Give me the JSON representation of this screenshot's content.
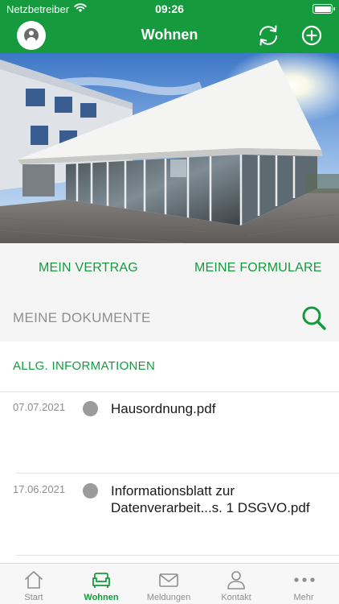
{
  "status_bar": {
    "carrier": "Netzbetreiber",
    "time": "09:26"
  },
  "header": {
    "title": "Wohnen",
    "icons": [
      "profile-icon",
      "refresh-icon",
      "add-icon"
    ]
  },
  "quick_links": {
    "contract": "MEIN VERTRAG",
    "forms": "MEINE FORMULARE",
    "documents": "MEINE DOKUMENTE"
  },
  "section": {
    "title": "ALLG. INFORMATIONEN"
  },
  "documents": [
    {
      "date": "07.07.2021",
      "name": "Hausordnung.pdf"
    },
    {
      "date": "17.06.2021",
      "name": "Informationsblatt zur Datenverarbeit...s. 1 DSGVO.pdf"
    }
  ],
  "tabs": [
    {
      "label": "Start",
      "icon": "house-icon",
      "active": false
    },
    {
      "label": "Wohnen",
      "icon": "sofa-icon",
      "active": true
    },
    {
      "label": "Meldungen",
      "icon": "envelope-icon",
      "active": false
    },
    {
      "label": "Kontakt",
      "icon": "person-icon",
      "active": false
    },
    {
      "label": "Mehr",
      "icon": "more-icon",
      "active": false
    }
  ],
  "colors": {
    "brand_green": "#159a3e",
    "muted_gray": "#8e8e8e"
  }
}
